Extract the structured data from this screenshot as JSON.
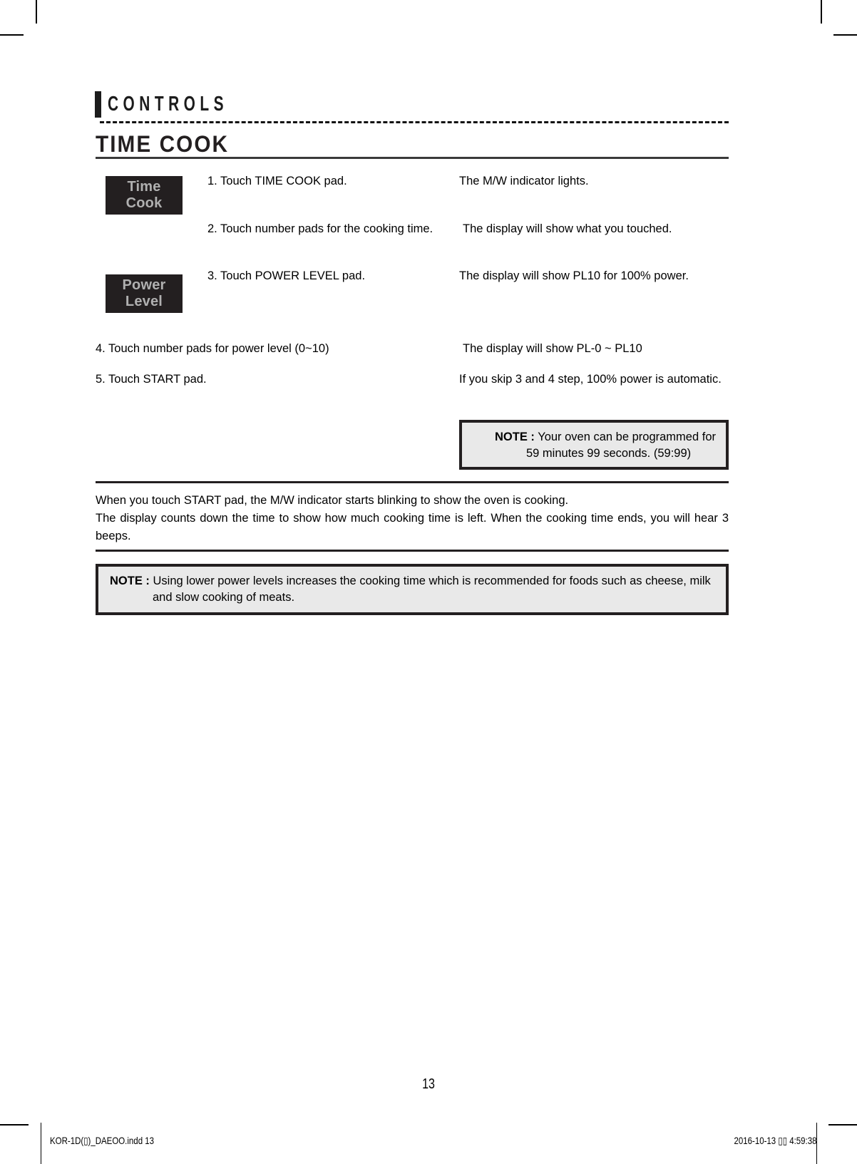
{
  "document": {
    "chapter_title": "CONTROLS",
    "section_title": "TIME COOK",
    "page_number": "13"
  },
  "pads": [
    {
      "name": "time-cook",
      "line1": "Time",
      "line2": "Cook"
    },
    {
      "name": "power-level",
      "line1": "Power",
      "line2": "Level"
    }
  ],
  "steps": [
    {
      "action": "1. Touch TIME COOK pad.",
      "result": "The M/W indicator lights."
    },
    {
      "action": "2. Touch number pads for the cooking time.",
      "result": "The display will show what you touched."
    },
    {
      "action": "3. Touch POWER LEVEL pad.",
      "result": "The display will show PL10 for 100% power."
    },
    {
      "action": "4. Touch number pads for power level (0~10)",
      "result": "The display will show PL-0 ~ PL10"
    },
    {
      "action": "5. Touch START pad.",
      "result": "If you skip 3 and 4 step, 100% power is automatic."
    }
  ],
  "note_top": {
    "label": "NOTE :",
    "line1": "Your oven can be programmed for",
    "line2": "59 minutes 99 seconds. (59:99)"
  },
  "paragraph": {
    "line1": "When you touch START pad, the M/W indicator starts blinking to show the oven is cooking.",
    "line2": "The display counts down the time to show how much cooking time is left. When the cooking time ends, you will hear 3 beeps."
  },
  "note_bottom": {
    "label": "NOTE :",
    "text": "Using lower power levels increases the cooking time which is recommended for foods such as cheese, milk and slow cooking of meats."
  },
  "footer": {
    "file": "KOR-1D(▯)_DAEOO.indd   13",
    "timestamp": "2016-10-13   ▯▯ 4:59:38"
  },
  "colors": {
    "pad_bg": "#231f20",
    "pad_text": "#b0b0b0",
    "note_bg": "#e9e9e9",
    "rule": "#231f20"
  }
}
